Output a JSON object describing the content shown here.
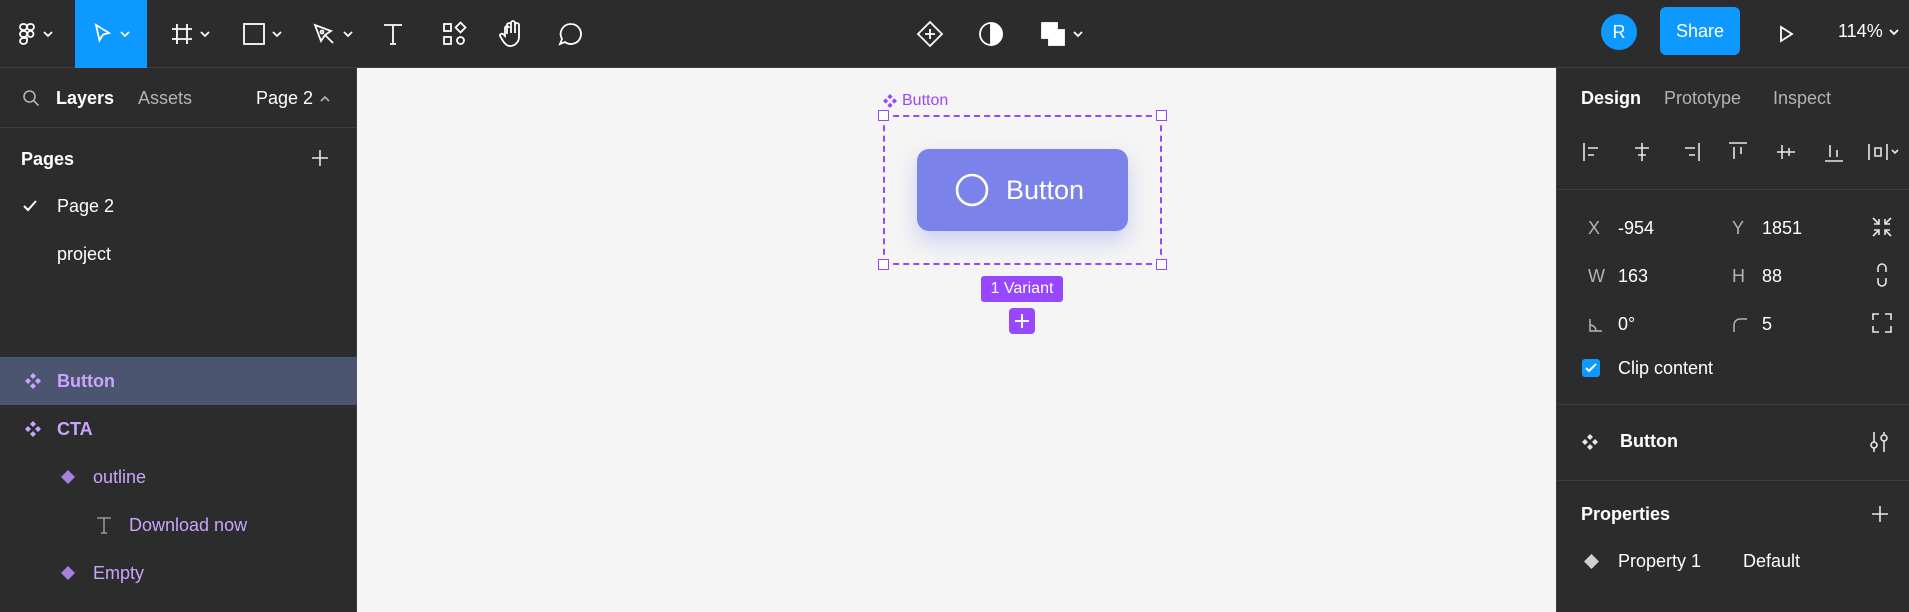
{
  "toolbar": {
    "tools": [
      "figma-menu-icon",
      "move-tool-icon",
      "frame-tool-icon",
      "shape-tool-icon",
      "pen-tool-icon",
      "text-tool-icon",
      "resources-icon",
      "hand-tool-icon",
      "comment-tool-icon"
    ],
    "center_tools": [
      "component-icon",
      "contrast-icon",
      "boolean-icon"
    ],
    "avatar_initial": "R",
    "share_label": "Share",
    "zoom": "114%"
  },
  "left_panel": {
    "tabs": {
      "layers": "Layers",
      "assets": "Assets"
    },
    "current_page": "Page 2",
    "pages_title": "Pages",
    "pages": [
      {
        "name": "Page 2",
        "selected": true
      },
      {
        "name": "project",
        "selected": false
      }
    ],
    "layers": [
      {
        "name": "Button",
        "type": "component-set",
        "selected": true,
        "indent": 0
      },
      {
        "name": "CTA",
        "type": "component",
        "selected": false,
        "indent": 0
      },
      {
        "name": "outline",
        "type": "instance",
        "selected": false,
        "indent": 1
      },
      {
        "name": "Download now",
        "type": "text",
        "selected": false,
        "indent": 2
      },
      {
        "name": "Empty",
        "type": "instance",
        "selected": false,
        "indent": 1
      }
    ]
  },
  "canvas": {
    "frame_label": "Button",
    "button_text": "Button",
    "variant_badge": "1 Variant",
    "accent_color": "#9747ff",
    "button_color": "#7b83eb"
  },
  "right_panel": {
    "tabs": {
      "design": "Design",
      "prototype": "Prototype",
      "inspect": "Inspect"
    },
    "x_label": "X",
    "x_value": "-954",
    "y_label": "Y",
    "y_value": "1851",
    "w_label": "W",
    "w_value": "163",
    "h_label": "H",
    "h_value": "88",
    "rotation": "0°",
    "radius": "5",
    "clip_content_label": "Clip content",
    "clip_content_checked": true,
    "component_name": "Button",
    "properties_title": "Properties",
    "property_name": "Property 1",
    "property_value": "Default"
  }
}
